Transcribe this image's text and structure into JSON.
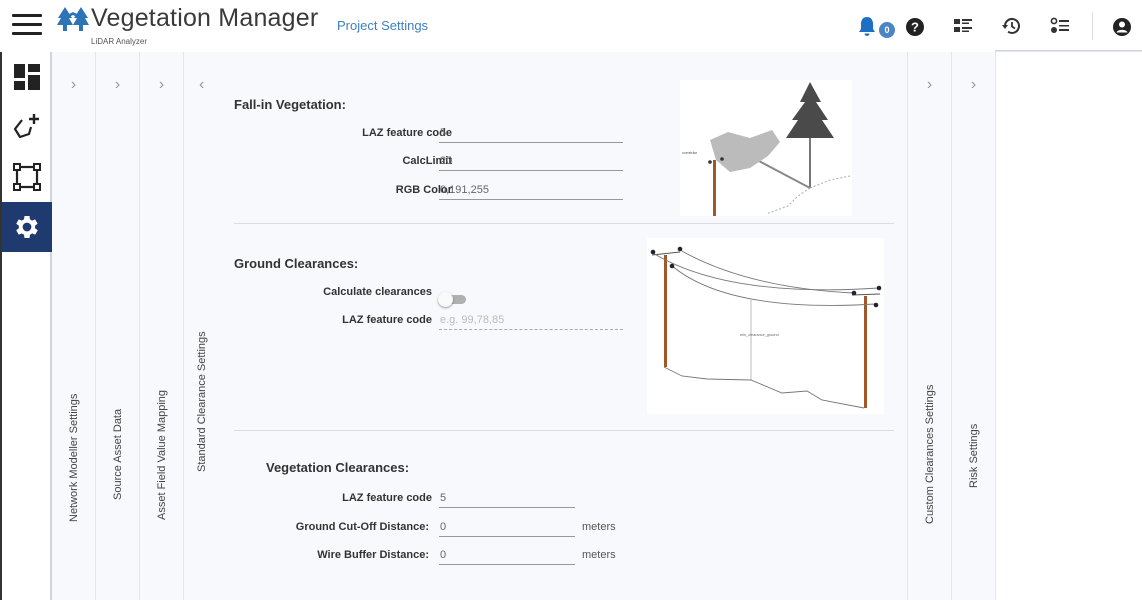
{
  "header": {
    "app_title": "Vegetation Manager",
    "app_subtitle": "LiDAR Analyzer",
    "breadcrumb": "Project Settings",
    "notification_count": "0",
    "icons": [
      "menu-icon",
      "app-logo-icon",
      "bell-icon",
      "help-icon",
      "list-view-icon",
      "history-icon",
      "checklist-icon",
      "account-icon"
    ]
  },
  "leftrail": {
    "items": [
      {
        "name": "dashboard",
        "icon": "dashboard-icon",
        "active": false
      },
      {
        "name": "add-polygon",
        "icon": "polygon-add-icon",
        "active": false
      },
      {
        "name": "selection",
        "icon": "bounding-box-icon",
        "active": false
      },
      {
        "name": "settings",
        "icon": "gear-icon",
        "active": true
      }
    ]
  },
  "panels": {
    "left": [
      {
        "label": "Network Modeller Settings",
        "chevron": "›"
      },
      {
        "label": "Source Asset Data",
        "chevron": "›"
      },
      {
        "label": "Asset Field Value Mapping",
        "chevron": "›"
      }
    ],
    "active": {
      "label": "Standard Clearance Settings",
      "chevron": "‹"
    },
    "right": [
      {
        "label": "Custom Clearances Settings",
        "chevron": "›"
      },
      {
        "label": "Risk Settings",
        "chevron": "›"
      }
    ]
  },
  "fall_in": {
    "title": "Fall-in Vegetation:",
    "fields": [
      {
        "label": "LAZ feature code",
        "value": "5"
      },
      {
        "label": "CalcLimit",
        "value": "20"
      },
      {
        "label": "RGB Color",
        "value": "0,191,255"
      }
    ],
    "illustration_label": "overstrike"
  },
  "ground": {
    "title": "Ground Clearances:",
    "toggle_label": "Calculate clearances",
    "toggle_on": false,
    "laz_label": "LAZ feature code",
    "laz_value": "",
    "laz_placeholder": "e.g. 99,78,85",
    "illustration_label": "min_clearance_ground"
  },
  "veg_clear": {
    "title": "Vegetation Clearances:",
    "fields": [
      {
        "label": "LAZ feature code",
        "value": "5",
        "unit": ""
      },
      {
        "label": "Ground Cut-Off Distance:",
        "value": "0",
        "unit": "meters"
      },
      {
        "label": "Wire Buffer Distance:",
        "value": "0",
        "unit": "meters"
      }
    ]
  }
}
